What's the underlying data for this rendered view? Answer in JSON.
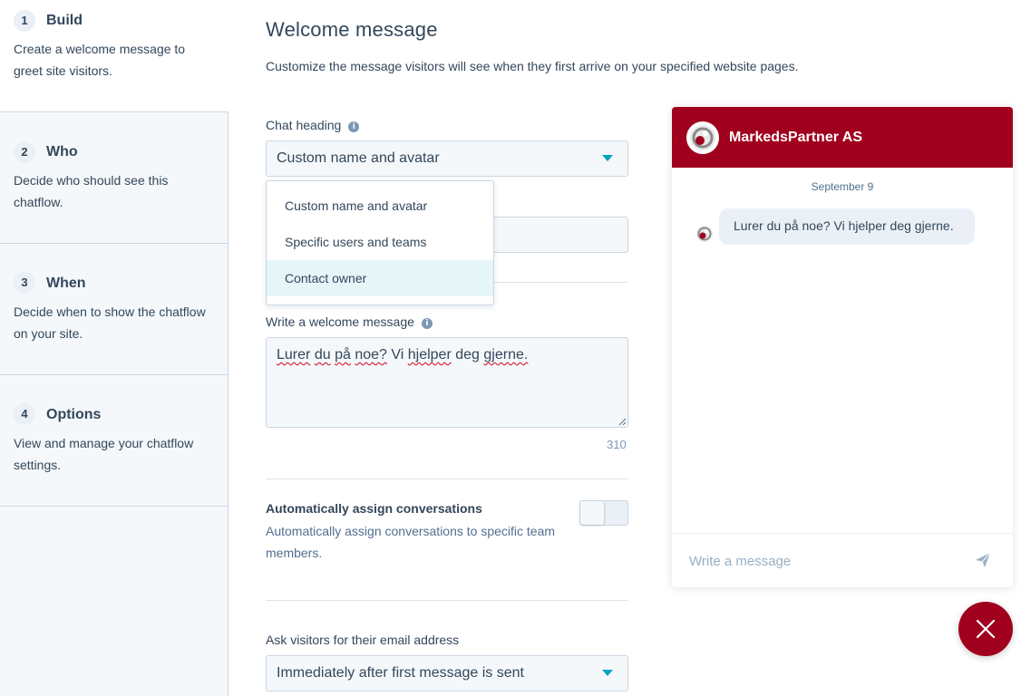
{
  "steps": [
    {
      "num": "1",
      "title": "Build",
      "desc": "Create a welcome message to greet site visitors."
    },
    {
      "num": "2",
      "title": "Who",
      "desc": "Decide who should see this chatflow."
    },
    {
      "num": "3",
      "title": "When",
      "desc": "Decide when to show the chatflow on your site."
    },
    {
      "num": "4",
      "title": "Options",
      "desc": "View and manage your chatflow settings."
    }
  ],
  "main": {
    "title": "Welcome message",
    "subtitle": "Customize the message visitors will see when they first arrive on your specified website pages.",
    "chat_heading": {
      "label": "Chat heading",
      "selected": "Custom name and avatar",
      "options": [
        "Custom name and avatar",
        "Specific users and teams",
        "Contact owner"
      ]
    },
    "welcome": {
      "label": "Write a welcome message",
      "words": [
        "Lurer",
        "du",
        "på",
        "noe?",
        "Vi",
        "hjelper",
        "deg",
        "gjerne."
      ],
      "char_count": "310"
    },
    "assign": {
      "label": "Automatically assign conversations",
      "desc": "Automatically assign conversations to specific team members.",
      "enabled": false
    },
    "email": {
      "label": "Ask visitors for their email address",
      "selected": "Immediately after first message is sent"
    }
  },
  "chat": {
    "name": "MarkedsPartner AS",
    "date": "September 9",
    "message": "Lurer du på noe? Vi hjelper deg gjerne.",
    "input_placeholder": "Write a message"
  },
  "icons": {
    "info": "info-icon",
    "caret": "caret-down-icon",
    "send": "send-icon",
    "close": "close-icon",
    "avatar": "brand-logo-icon"
  },
  "colors": {
    "brand": "#a0001d",
    "accent": "#00a4bd",
    "text": "#33475b",
    "sidebar_bg": "#f5f8fa"
  }
}
